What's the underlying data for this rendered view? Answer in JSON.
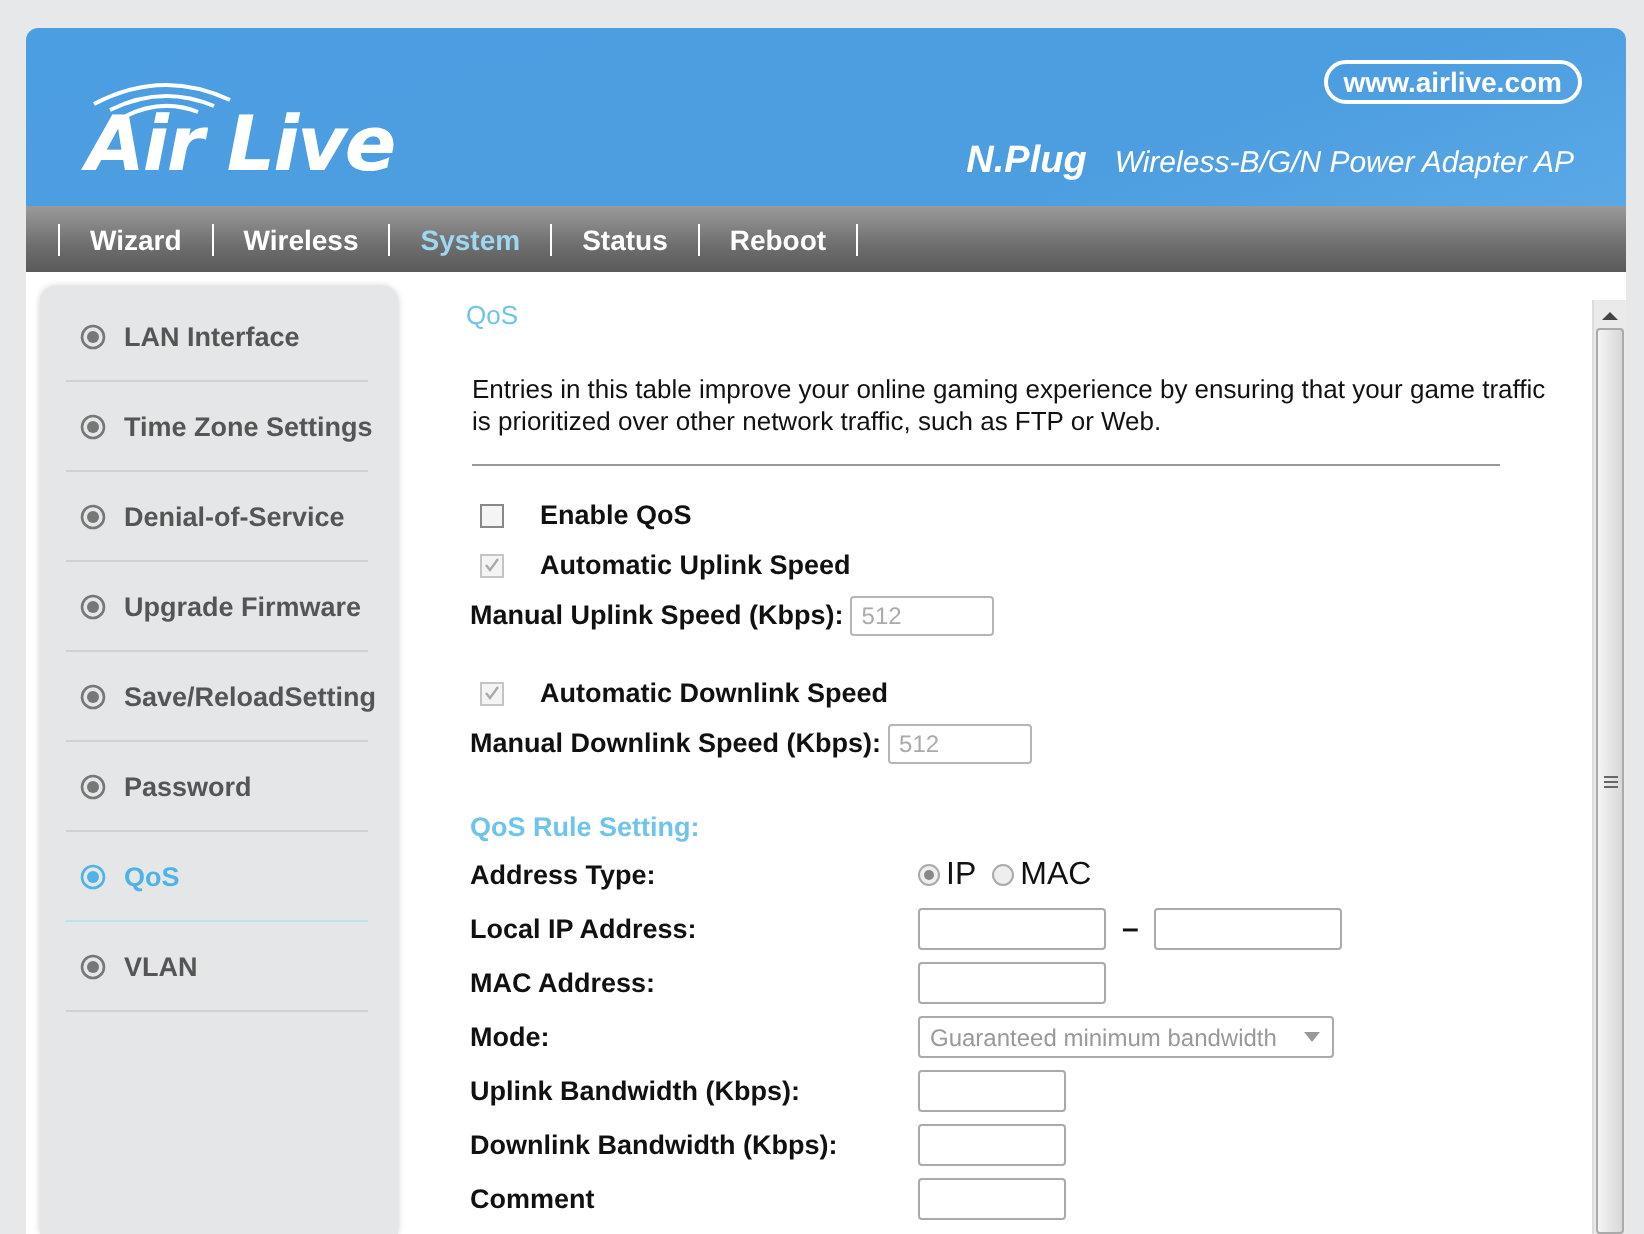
{
  "header": {
    "logo": "Air Live",
    "website": "www.airlive.com",
    "product": "N.Plug",
    "subtitle": "Wireless-B/G/N Power Adapter AP"
  },
  "nav": [
    {
      "label": "Wizard",
      "selected": false
    },
    {
      "label": "Wireless",
      "selected": false
    },
    {
      "label": "System",
      "selected": true
    },
    {
      "label": "Status",
      "selected": false
    },
    {
      "label": "Reboot",
      "selected": false
    }
  ],
  "sidebar": {
    "items": [
      {
        "label": "LAN Interface",
        "selected": false
      },
      {
        "label": "Time Zone Settings",
        "selected": false
      },
      {
        "label": "Denial-of-Service",
        "selected": false
      },
      {
        "label": "Upgrade Firmware",
        "selected": false
      },
      {
        "label": "Save/ReloadSetting",
        "selected": false
      },
      {
        "label": "Password",
        "selected": false
      },
      {
        "label": "QoS",
        "selected": true
      },
      {
        "label": "VLAN",
        "selected": false
      }
    ]
  },
  "main": {
    "title": "QoS",
    "description": "Entries in this table improve your online gaming experience by ensuring that your game traffic is prioritized over other network traffic, such as FTP or Web.",
    "settings": [
      {
        "kind": "checkbox",
        "label": "Enable QoS",
        "checked": false,
        "disabled": false
      },
      {
        "kind": "checkbox",
        "label": "Automatic Uplink Speed",
        "checked": true,
        "disabled": true
      },
      {
        "kind": "input",
        "label": "Manual Uplink Speed (Kbps):",
        "value": "512",
        "disabled": true
      },
      {
        "kind": "checkbox",
        "label": "Automatic Downlink Speed",
        "checked": true,
        "disabled": true
      },
      {
        "kind": "input",
        "label": "Manual Downlink Speed (Kbps):",
        "value": "512",
        "disabled": true
      }
    ],
    "rule_section": {
      "title": "QoS Rule Setting:",
      "rows": [
        {
          "kind": "radio",
          "label": "Address Type:",
          "options": [
            {
              "label": "IP",
              "selected": true
            },
            {
              "label": "MAC",
              "selected": false
            }
          ]
        },
        {
          "kind": "range",
          "label": "Local IP Address:",
          "separator": "–"
        },
        {
          "kind": "input",
          "label": "MAC Address:"
        },
        {
          "kind": "select",
          "label": "Mode:",
          "value": "Guaranteed minimum bandwidth"
        },
        {
          "kind": "input",
          "label": "Uplink Bandwidth (Kbps):"
        },
        {
          "kind": "input",
          "label": "Downlink Bandwidth (Kbps):"
        },
        {
          "kind": "input",
          "label": "Comment"
        }
      ]
    }
  }
}
